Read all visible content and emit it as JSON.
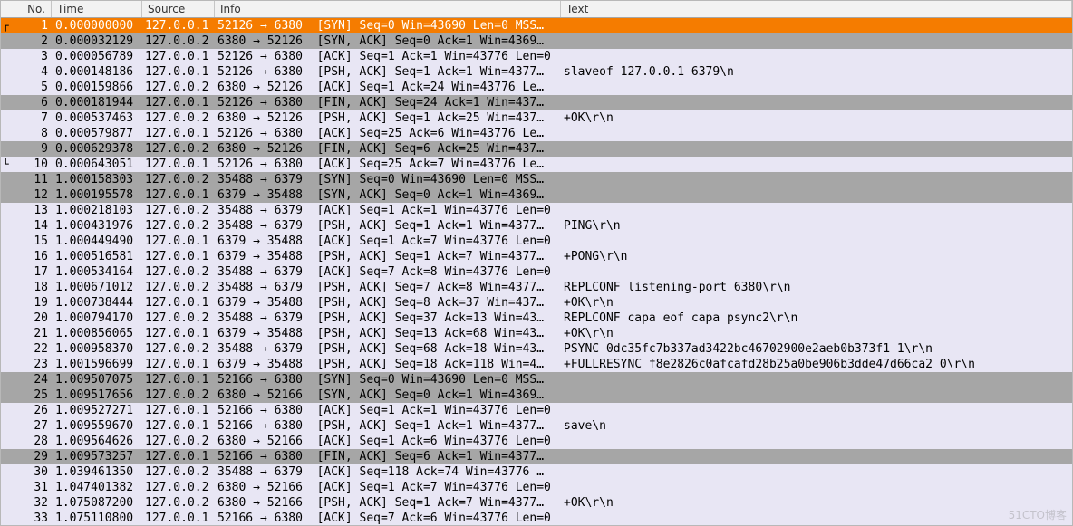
{
  "columns": {
    "no": "No.",
    "time": "Time",
    "src": "Source",
    "info": "Info",
    "text": "Text"
  },
  "colors": {
    "selected": "#f57c00",
    "grey": "#a6a6a6",
    "light": "#e8e6f4",
    "selected_fg": "#ffffff"
  },
  "rows": [
    {
      "no": 1,
      "time": "0.000000000",
      "src": "127.0.0.1",
      "info": "52126 → 6380  [SYN] Seq=0 Win=43690 Len=0 MSS…",
      "text": "",
      "color": "selected",
      "mark": "start"
    },
    {
      "no": 2,
      "time": "0.000032129",
      "src": "127.0.0.2",
      "info": "6380 → 52126  [SYN, ACK] Seq=0 Ack=1 Win=4369…",
      "text": "",
      "color": "grey"
    },
    {
      "no": 3,
      "time": "0.000056789",
      "src": "127.0.0.1",
      "info": "52126 → 6380  [ACK] Seq=1 Ack=1 Win=43776 Len=0",
      "text": "",
      "color": "light"
    },
    {
      "no": 4,
      "time": "0.000148186",
      "src": "127.0.0.1",
      "info": "52126 → 6380  [PSH, ACK] Seq=1 Ack=1 Win=4377…",
      "text": "slaveof 127.0.0.1 6379\\n",
      "color": "light"
    },
    {
      "no": 5,
      "time": "0.000159866",
      "src": "127.0.0.2",
      "info": "6380 → 52126  [ACK] Seq=1 Ack=24 Win=43776 Le…",
      "text": "",
      "color": "light"
    },
    {
      "no": 6,
      "time": "0.000181944",
      "src": "127.0.0.1",
      "info": "52126 → 6380  [FIN, ACK] Seq=24 Ack=1 Win=437…",
      "text": "",
      "color": "grey"
    },
    {
      "no": 7,
      "time": "0.000537463",
      "src": "127.0.0.2",
      "info": "6380 → 52126  [PSH, ACK] Seq=1 Ack=25 Win=437…",
      "text": "+OK\\r\\n",
      "color": "light"
    },
    {
      "no": 8,
      "time": "0.000579877",
      "src": "127.0.0.1",
      "info": "52126 → 6380  [ACK] Seq=25 Ack=6 Win=43776 Le…",
      "text": "",
      "color": "light"
    },
    {
      "no": 9,
      "time": "0.000629378",
      "src": "127.0.0.2",
      "info": "6380 → 52126  [FIN, ACK] Seq=6 Ack=25 Win=437…",
      "text": "",
      "color": "grey"
    },
    {
      "no": 10,
      "time": "0.000643051",
      "src": "127.0.0.1",
      "info": "52126 → 6380  [ACK] Seq=25 Ack=7 Win=43776 Le…",
      "text": "",
      "color": "light",
      "mark": "end"
    },
    {
      "no": 11,
      "time": "1.000158303",
      "src": "127.0.0.2",
      "info": "35488 → 6379  [SYN] Seq=0 Win=43690 Len=0 MSS…",
      "text": "",
      "color": "grey"
    },
    {
      "no": 12,
      "time": "1.000195578",
      "src": "127.0.0.1",
      "info": "6379 → 35488  [SYN, ACK] Seq=0 Ack=1 Win=4369…",
      "text": "",
      "color": "grey"
    },
    {
      "no": 13,
      "time": "1.000218103",
      "src": "127.0.0.2",
      "info": "35488 → 6379  [ACK] Seq=1 Ack=1 Win=43776 Len=0",
      "text": "",
      "color": "light"
    },
    {
      "no": 14,
      "time": "1.000431976",
      "src": "127.0.0.2",
      "info": "35488 → 6379  [PSH, ACK] Seq=1 Ack=1 Win=4377…",
      "text": "PING\\r\\n",
      "color": "light"
    },
    {
      "no": 15,
      "time": "1.000449490",
      "src": "127.0.0.1",
      "info": "6379 → 35488  [ACK] Seq=1 Ack=7 Win=43776 Len=0",
      "text": "",
      "color": "light"
    },
    {
      "no": 16,
      "time": "1.000516581",
      "src": "127.0.0.1",
      "info": "6379 → 35488  [PSH, ACK] Seq=1 Ack=7 Win=4377…",
      "text": "+PONG\\r\\n",
      "color": "light"
    },
    {
      "no": 17,
      "time": "1.000534164",
      "src": "127.0.0.2",
      "info": "35488 → 6379  [ACK] Seq=7 Ack=8 Win=43776 Len=0",
      "text": "",
      "color": "light"
    },
    {
      "no": 18,
      "time": "1.000671012",
      "src": "127.0.0.2",
      "info": "35488 → 6379  [PSH, ACK] Seq=7 Ack=8 Win=4377…",
      "text": "REPLCONF listening-port 6380\\r\\n",
      "color": "light"
    },
    {
      "no": 19,
      "time": "1.000738444",
      "src": "127.0.0.1",
      "info": "6379 → 35488  [PSH, ACK] Seq=8 Ack=37 Win=437…",
      "text": "+OK\\r\\n",
      "color": "light"
    },
    {
      "no": 20,
      "time": "1.000794170",
      "src": "127.0.0.2",
      "info": "35488 → 6379  [PSH, ACK] Seq=37 Ack=13 Win=43…",
      "text": "REPLCONF capa eof capa psync2\\r\\n",
      "color": "light"
    },
    {
      "no": 21,
      "time": "1.000856065",
      "src": "127.0.0.1",
      "info": "6379 → 35488  [PSH, ACK] Seq=13 Ack=68 Win=43…",
      "text": "+OK\\r\\n",
      "color": "light"
    },
    {
      "no": 22,
      "time": "1.000958370",
      "src": "127.0.0.2",
      "info": "35488 → 6379  [PSH, ACK] Seq=68 Ack=18 Win=43…",
      "text": "PSYNC 0dc35fc7b337ad3422bc46702900e2aeb0b373f1 1\\r\\n",
      "color": "light"
    },
    {
      "no": 23,
      "time": "1.001596699",
      "src": "127.0.0.1",
      "info": "6379 → 35488  [PSH, ACK] Seq=18 Ack=118 Win=4…",
      "text": "+FULLRESYNC f8e2826c0afcafd28b25a0be906b3dde47d66ca2 0\\r\\n",
      "color": "light"
    },
    {
      "no": 24,
      "time": "1.009507075",
      "src": "127.0.0.1",
      "info": "52166 → 6380  [SYN] Seq=0 Win=43690 Len=0 MSS…",
      "text": "",
      "color": "grey"
    },
    {
      "no": 25,
      "time": "1.009517656",
      "src": "127.0.0.2",
      "info": "6380 → 52166  [SYN, ACK] Seq=0 Ack=1 Win=4369…",
      "text": "",
      "color": "grey"
    },
    {
      "no": 26,
      "time": "1.009527271",
      "src": "127.0.0.1",
      "info": "52166 → 6380  [ACK] Seq=1 Ack=1 Win=43776 Len=0",
      "text": "",
      "color": "light"
    },
    {
      "no": 27,
      "time": "1.009559670",
      "src": "127.0.0.1",
      "info": "52166 → 6380  [PSH, ACK] Seq=1 Ack=1 Win=4377…",
      "text": "save\\n",
      "color": "light"
    },
    {
      "no": 28,
      "time": "1.009564626",
      "src": "127.0.0.2",
      "info": "6380 → 52166  [ACK] Seq=1 Ack=6 Win=43776 Len=0",
      "text": "",
      "color": "light"
    },
    {
      "no": 29,
      "time": "1.009573257",
      "src": "127.0.0.1",
      "info": "52166 → 6380  [FIN, ACK] Seq=6 Ack=1 Win=4377…",
      "text": "",
      "color": "grey"
    },
    {
      "no": 30,
      "time": "1.039461350",
      "src": "127.0.0.2",
      "info": "35488 → 6379  [ACK] Seq=118 Ack=74 Win=43776 …",
      "text": "",
      "color": "light"
    },
    {
      "no": 31,
      "time": "1.047401382",
      "src": "127.0.0.2",
      "info": "6380 → 52166  [ACK] Seq=1 Ack=7 Win=43776 Len=0",
      "text": "",
      "color": "light"
    },
    {
      "no": 32,
      "time": "1.075087200",
      "src": "127.0.0.2",
      "info": "6380 → 52166  [PSH, ACK] Seq=1 Ack=7 Win=4377…",
      "text": "+OK\\r\\n",
      "color": "light"
    },
    {
      "no": 33,
      "time": "1.075110800",
      "src": "127.0.0.1",
      "info": "52166 → 6380  [ACK] Seq=7 Ack=6 Win=43776 Len=0",
      "text": "",
      "color": "light"
    }
  ],
  "watermark": "51CTO博客"
}
